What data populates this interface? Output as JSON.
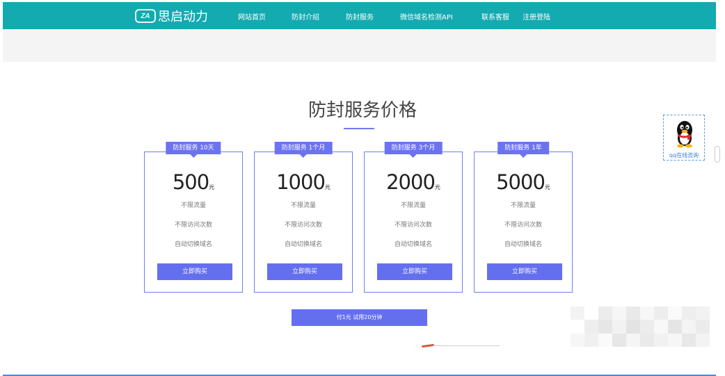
{
  "header": {
    "logo_mark": "ZA",
    "logo_text": "思启动力",
    "nav": [
      {
        "label": "网站首页"
      },
      {
        "label": "防封介绍"
      },
      {
        "label": "防封服务"
      },
      {
        "label": "微信域名检测API"
      },
      {
        "label": "联系客服"
      },
      {
        "label": "注册登陆"
      }
    ]
  },
  "section": {
    "title": "防封服务价格"
  },
  "plans": [
    {
      "badge": "防封服务 10天",
      "price": "500",
      "unit": "元",
      "features": [
        "不限流量",
        "不限访问次数",
        "自动切换域名"
      ],
      "button": "立即购买"
    },
    {
      "badge": "防封服务 1个月",
      "price": "1000",
      "unit": "元",
      "features": [
        "不限流量",
        "不限访问次数",
        "自动切换域名"
      ],
      "button": "立即购买"
    },
    {
      "badge": "防封服务 3个月",
      "price": "2000",
      "unit": "元",
      "features": [
        "不限流量",
        "不限访问次数",
        "自动切换域名"
      ],
      "button": "立即购买"
    },
    {
      "badge": "防封服务 1年",
      "price": "5000",
      "unit": "元",
      "features": [
        "不限流量",
        "不限访问次数",
        "自动切换域名"
      ],
      "button": "立即购买"
    }
  ],
  "trial": {
    "label": "付1元 试用20分钟"
  },
  "qq": {
    "icon": "qq-penguin-icon",
    "label": "qq在线咨询"
  },
  "colors": {
    "header_bg": "#13aab0",
    "accent": "#646ff0",
    "card_border": "#6f7df0"
  }
}
